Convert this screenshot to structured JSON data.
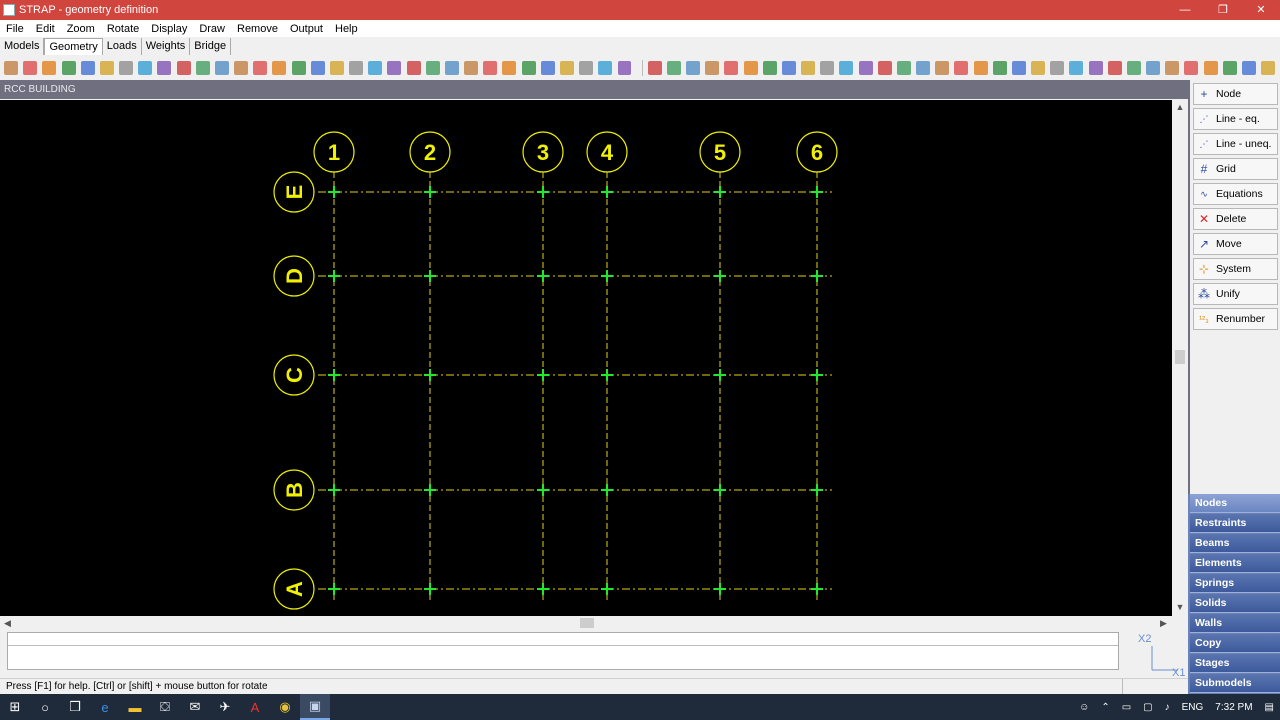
{
  "window": {
    "title": "STRAP - geometry definition",
    "controls": [
      "—",
      "❐",
      "✕"
    ]
  },
  "menu": [
    "File",
    "Edit",
    "Zoom",
    "Rotate",
    "Display",
    "Draw",
    "Remove",
    "Output",
    "Help"
  ],
  "tabs": [
    {
      "label": "Models",
      "active": false
    },
    {
      "label": "Geometry",
      "active": true
    },
    {
      "label": "Loads",
      "active": false
    },
    {
      "label": "Weights",
      "active": false
    },
    {
      "label": "Bridge",
      "active": false
    }
  ],
  "model_name": "RCC BUILDING",
  "grid": {
    "columns": [
      "1",
      "2",
      "3",
      "4",
      "5",
      "6"
    ],
    "rows": [
      "E",
      "D",
      "C",
      "B",
      "A"
    ],
    "colors": {
      "label": "#f0f000",
      "gridline": "#e0d21a",
      "node": "#22e82c",
      "background": "#000000"
    }
  },
  "right_panel": {
    "buttons": [
      {
        "label": "Node",
        "icon": "plus-icon"
      },
      {
        "label": "Line - eq.",
        "icon": "line-eq-icon"
      },
      {
        "label": "Line - uneq.",
        "icon": "line-uneq-icon"
      },
      {
        "label": "Grid",
        "icon": "grid-icon"
      },
      {
        "label": "Equations",
        "icon": "equations-icon"
      },
      {
        "label": "Delete",
        "icon": "delete-icon"
      },
      {
        "label": "Move",
        "icon": "move-icon"
      },
      {
        "label": "System",
        "icon": "system-icon"
      },
      {
        "label": "Unify",
        "icon": "unify-icon"
      },
      {
        "label": "Renumber",
        "icon": "renumber-icon"
      }
    ],
    "categories": [
      "Nodes",
      "Restraints",
      "Beams",
      "Elements",
      "Springs",
      "Solids",
      "Walls",
      "Copy",
      "Stages",
      "Submodels"
    ],
    "active_category": "Nodes"
  },
  "axes_indicator": {
    "labels": [
      "X2",
      "X1"
    ]
  },
  "status": {
    "text": "Press [F1] for help. [Ctrl] or [shift] + mouse button for rotate"
  },
  "taskbar": {
    "tray": {
      "language": "ENG",
      "time": "7:32 PM"
    }
  }
}
